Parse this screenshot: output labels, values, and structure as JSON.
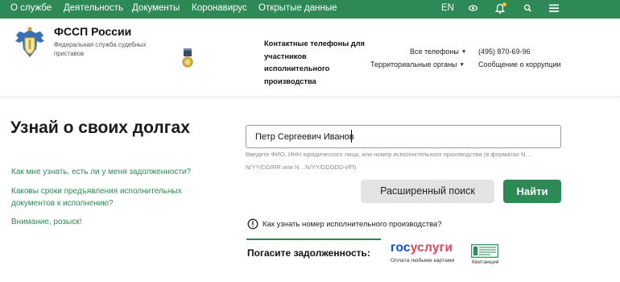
{
  "topnav": {
    "items": [
      "О службе",
      "Деятельность",
      "Документы",
      "Коронавирус",
      "Открытые данные"
    ],
    "lang": "EN",
    "icons": [
      "eye-icon",
      "bell-icon",
      "search-icon",
      "menu-icon"
    ]
  },
  "header": {
    "org_name": "ФССП России",
    "org_subtitle": "Федеральная служба судебных приставов",
    "contacts_title": "Контактные телефоны для участников исполнительного производства",
    "all_phones": "Все телефоны",
    "territorial": "Территориальные органы",
    "phone": "(495) 870-69-96",
    "corruption": "Сообщение о коррупции"
  },
  "main": {
    "title": "Узнай о своих долгах",
    "links": [
      "Как мне узнать, есть ли у меня задолженности?",
      "Каковы сроки предъявления исполнительных документов к исполнению?",
      "Внимание, розыск!"
    ],
    "search_value": "Петр Сергеевич Иванов",
    "search_hint": "Введите ФИО, ИНН юридического лица, или номер исполнительного производства (в форматах N…N/YY/DD/RR или N…N/YY/DDDDD-ИП)",
    "advanced_search": "Расширенный поиск",
    "find": "Найти",
    "info_link": "Как узнать номер исполнительного производства?",
    "pay_label": "Погасите задолженность:",
    "gos_part1": "гос",
    "gos_part2": "услуги",
    "gos_sub": "Оплата любыми картами",
    "receipt": "Квитанция"
  },
  "colors": {
    "brand_green": "#2d8a57",
    "gos_blue": "#0d4cd3",
    "gos_red": "#ee3f58",
    "bell_dot": "#f4c430"
  }
}
